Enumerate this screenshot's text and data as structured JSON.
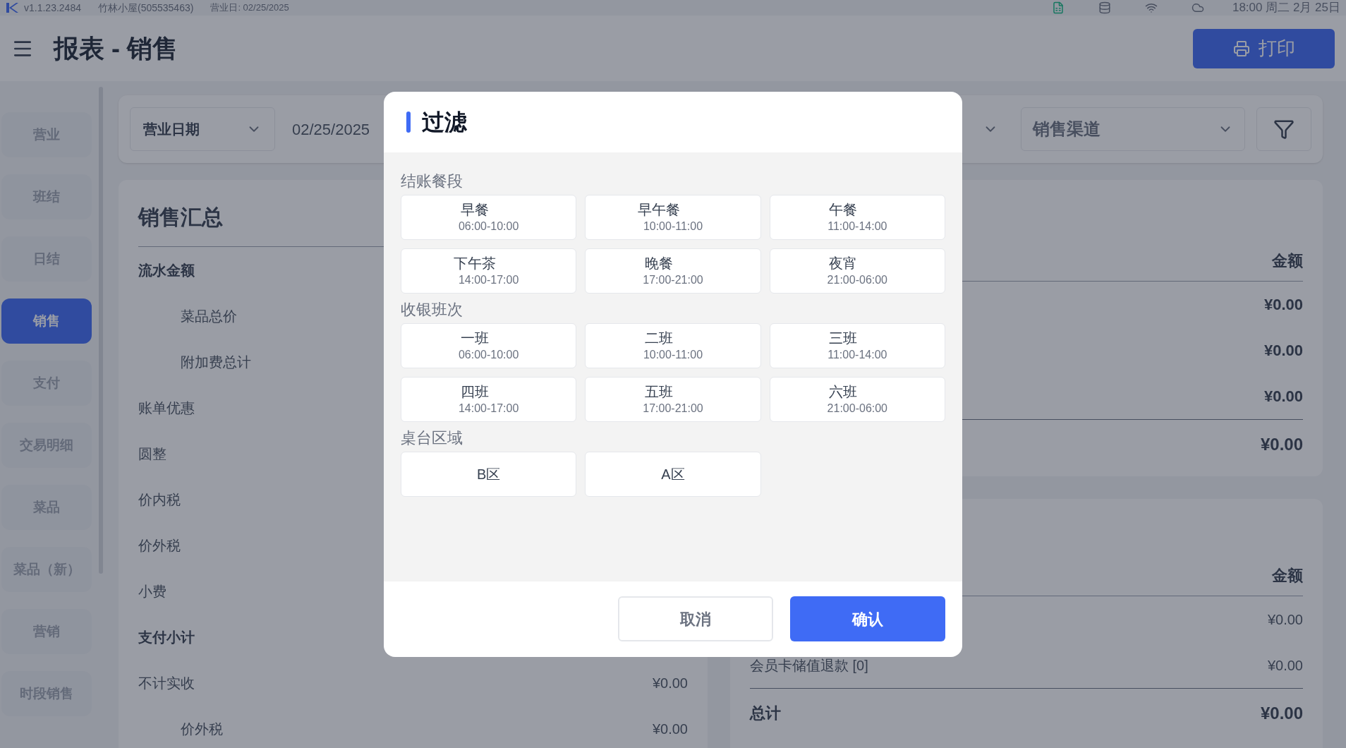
{
  "status_bar": {
    "version": "v1.1.23.2484",
    "store": "竹林小屋(505535463)",
    "business_day": "营业日: 02/25/2025",
    "clock": "18:00 周二 2月 25日"
  },
  "header": {
    "title": "报表 - 销售",
    "print_button": "打印"
  },
  "sidebar": {
    "items": [
      {
        "label": "营业",
        "selected": false
      },
      {
        "label": "班结",
        "selected": false
      },
      {
        "label": "日结",
        "selected": false
      },
      {
        "label": "销售",
        "selected": true
      },
      {
        "label": "支付",
        "selected": false
      },
      {
        "label": "交易明细",
        "selected": false
      },
      {
        "label": "菜品",
        "selected": false
      },
      {
        "label": "菜品（新）",
        "selected": false
      },
      {
        "label": "营销",
        "selected": false
      },
      {
        "label": "时段销售",
        "selected": false
      }
    ]
  },
  "filter_bar": {
    "date_type": "营业日期",
    "date": "02/25/2025",
    "channel": "销售渠道"
  },
  "sales_summary": {
    "title": "销售汇总",
    "rows": [
      {
        "label": "流水金额",
        "kind": "bold",
        "indented": false
      },
      {
        "label": "菜品总价",
        "kind": "plain",
        "indented": true
      },
      {
        "label": "附加费总计",
        "kind": "plain",
        "indented": true
      },
      {
        "label": "账单优惠",
        "kind": "plain",
        "indented": false
      },
      {
        "label": "圆整",
        "kind": "plain",
        "indented": false
      },
      {
        "label": "价内税",
        "kind": "plain",
        "indented": false
      },
      {
        "label": "价外税",
        "kind": "plain",
        "indented": false
      },
      {
        "label": "小费",
        "kind": "plain",
        "indented": false
      },
      {
        "label": "支付小计",
        "kind": "bold",
        "indented": false
      },
      {
        "label": "不计实收",
        "kind": "plain",
        "indented": false,
        "value": "¥0.00"
      },
      {
        "label": "价外税",
        "kind": "plain",
        "indented": true,
        "value": "¥0.00"
      }
    ]
  },
  "right_card_1": {
    "column": "金额",
    "rows": [
      {
        "value": "¥0.00",
        "kind": "bold"
      },
      {
        "value": "¥0.00",
        "kind": "bold"
      },
      {
        "value": "¥0.00",
        "kind": "bold"
      },
      {
        "value": "¥0.00",
        "kind": "total"
      }
    ]
  },
  "right_card_2": {
    "column": "金额",
    "rows": [
      {
        "value": "¥0.00",
        "kind": "plain"
      },
      {
        "label": "会员卡储值退款 [0]",
        "value": "¥0.00",
        "kind": "plain"
      },
      {
        "label": "总计",
        "value": "¥0.00",
        "kind": "total"
      }
    ]
  },
  "dialog": {
    "title": "过滤",
    "sections": [
      {
        "title": "结账餐段",
        "options": [
          {
            "name": "早餐",
            "time": "06:00-10:00",
            "selected": false
          },
          {
            "name": "早午餐",
            "time": "10:00-11:00",
            "selected": false
          },
          {
            "name": "午餐",
            "time": "11:00-14:00",
            "selected": false
          },
          {
            "name": "下午茶",
            "time": "14:00-17:00",
            "selected": false
          },
          {
            "name": "晚餐",
            "time": "17:00-21:00",
            "selected": false
          },
          {
            "name": "夜宵",
            "time": "21:00-06:00",
            "selected": false
          }
        ]
      },
      {
        "title": "收银班次",
        "options": [
          {
            "name": "一班",
            "time": "06:00-10:00",
            "selected": false
          },
          {
            "name": "二班",
            "time": "10:00-11:00",
            "selected": false
          },
          {
            "name": "三班",
            "time": "11:00-14:00",
            "selected": false
          },
          {
            "name": "四班",
            "time": "14:00-17:00",
            "selected": false
          },
          {
            "name": "五班",
            "time": "17:00-21:00",
            "selected": false
          },
          {
            "name": "六班",
            "time": "21:00-06:00",
            "selected": false
          }
        ]
      },
      {
        "title": "桌台区域",
        "options": [
          {
            "name": "B区",
            "selected": false
          },
          {
            "name": "A区",
            "selected": false
          }
        ]
      }
    ],
    "cancel": "取消",
    "confirm": "确认"
  }
}
